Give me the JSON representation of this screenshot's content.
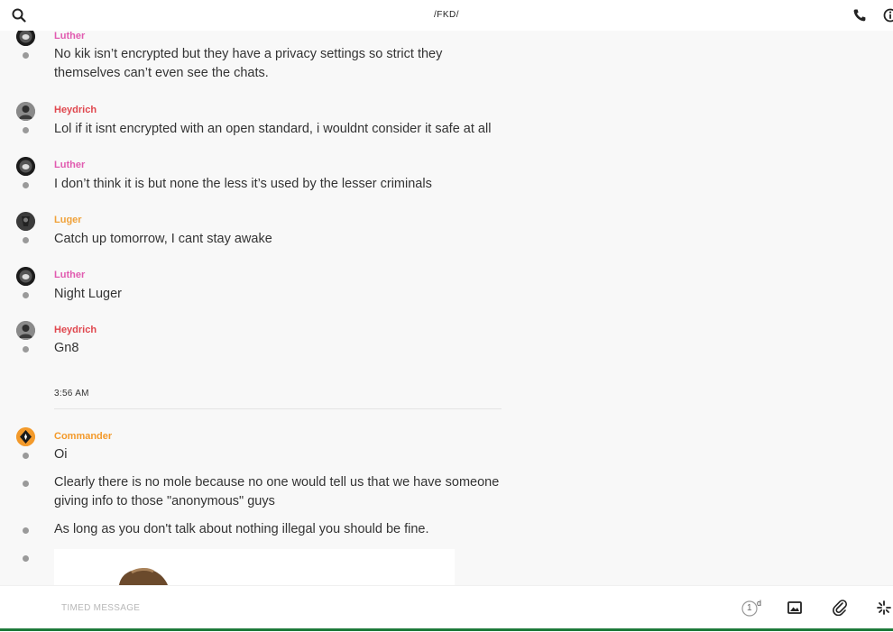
{
  "header": {
    "title": "/FKD/"
  },
  "composer": {
    "placeholder": "TIMED MESSAGE",
    "timer_value": "1",
    "timer_unit": "d"
  },
  "colors": {
    "luther": "#e15bb0",
    "heydrich": "#e0474e",
    "luger": "#f0a23a",
    "commander": "#f39a2b"
  },
  "messages": [
    {
      "sender": "Luther",
      "lines": [
        "No kik isn’t encrypted but they have a privacy settings so strict they",
        "themselves can’t even see the chats."
      ]
    },
    {
      "sender": "Heydrich",
      "lines": [
        "Lol if it isnt encrypted with an open standard, i wouldnt consider it safe at all"
      ]
    },
    {
      "sender": "Luther",
      "lines": [
        "I don’t think it is but none the less it’s used by the lesser criminals"
      ]
    },
    {
      "sender": "Luger",
      "lines": [
        "Catch  up tomorrow, I cant stay awake"
      ]
    },
    {
      "sender": "Luther",
      "lines": [
        "Night Luger"
      ]
    },
    {
      "sender": "Heydrich",
      "lines": [
        "Gn8"
      ]
    }
  ],
  "timestamp": "3:56 AM",
  "commander": {
    "sender": "Commander",
    "messages": [
      [
        "Oi"
      ],
      [
        "Clearly there is no mole because no one would tell us that we have someone",
        "giving info to those \"anonymous\" guys"
      ],
      [
        "As long as you don't talk about nothing illegal you should be fine."
      ]
    ]
  }
}
